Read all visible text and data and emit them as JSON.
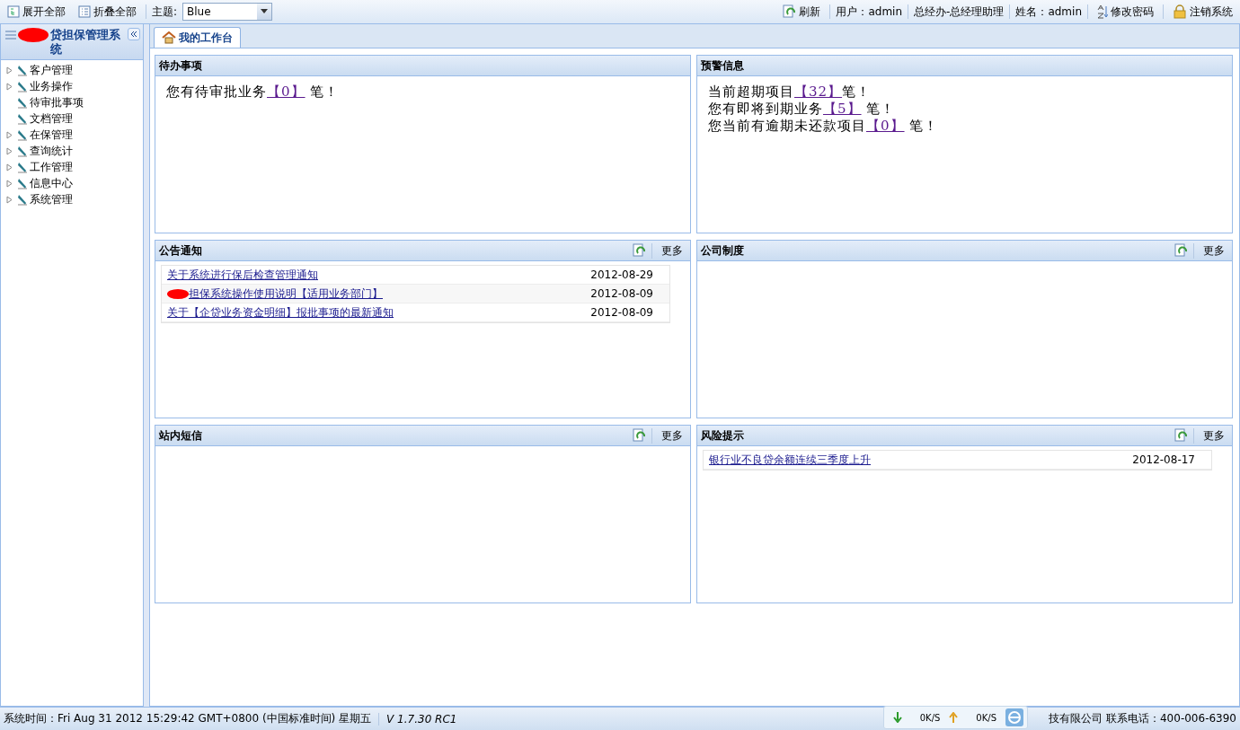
{
  "toolbar": {
    "buttons": [
      {
        "kind": "expand",
        "label": "展开全部"
      },
      {
        "kind": "collapse",
        "label": "折叠全部"
      }
    ],
    "theme": {
      "label": "主题:",
      "value": "Blue"
    }
  },
  "top_right": [
    {
      "kind": "refresh",
      "label": "刷新"
    },
    {
      "kind": "text",
      "label": "用户：admin"
    },
    {
      "kind": "text",
      "label": "总经办-总经理助理"
    },
    {
      "kind": "text",
      "label": "姓名：admin"
    },
    {
      "kind": "password",
      "label": "修改密码"
    },
    {
      "kind": "logout",
      "label": "注销系统"
    }
  ],
  "sidebar": {
    "title": "贷担保管理系统",
    "redacted": true,
    "items": [
      {
        "label": "客户管理",
        "expandable": true
      },
      {
        "label": "业务操作",
        "expandable": true
      },
      {
        "label": "待审批事项",
        "expandable": false
      },
      {
        "label": "文档管理",
        "expandable": false
      },
      {
        "label": "在保管理",
        "expandable": true
      },
      {
        "label": "查询统计",
        "expandable": true
      },
      {
        "label": "工作管理",
        "expandable": true
      },
      {
        "label": "信息中心",
        "expandable": true
      },
      {
        "label": "系统管理",
        "expandable": true
      }
    ]
  },
  "tabs": [
    {
      "label": "我的工作台",
      "selected": true
    }
  ],
  "panels": [
    {
      "title": "待办事项",
      "kind": "messages",
      "lines": [
        {
          "text": "您有待审批业务",
          "count": "【0】",
          "suffix": " 笔！"
        }
      ]
    },
    {
      "title": "预警信息",
      "kind": "messages",
      "lines": [
        {
          "text": "当前超期项目",
          "count": "【32】",
          "suffix": "笔！"
        },
        {
          "text": "您有即将到期业务",
          "count": "【5】",
          "suffix": " 笔！"
        },
        {
          "text": "您当前有逾期未还款项目",
          "count": "【0】",
          "suffix": " 笔！"
        }
      ]
    },
    {
      "title": "公告通知",
      "kind": "list",
      "more": "更多",
      "rows": [
        {
          "title": "关于系统进行保后检查管理通知",
          "date": "2012-08-29",
          "redacted": false
        },
        {
          "title": "担保系统操作使用说明【适用业务部门】",
          "date": "2012-08-09",
          "redacted": true
        },
        {
          "title": "关于【企贷业务资金明细】报批事项的最新通知",
          "date": "2012-08-09",
          "redacted": false
        }
      ]
    },
    {
      "title": "公司制度",
      "kind": "list",
      "more": "更多"
    },
    {
      "title": "站内短信",
      "kind": "list",
      "more": "更多"
    },
    {
      "title": "风险提示",
      "kind": "list",
      "more": "更多",
      "rows": [
        {
          "title": "银行业不良贷余额连续三季度上升",
          "date": "2012-08-17",
          "redacted": false
        }
      ]
    }
  ],
  "status_bar": {
    "time": "系统时间：Fri Aug 31 2012 15:29:42 GMT+0800 (中国标准时间) 星期五",
    "version": "V 1.7.30 RC1",
    "company": "技有限公司 联系电话：400-006-6390"
  },
  "net_widget": {
    "down": "0K/S",
    "up": "0K/S"
  }
}
